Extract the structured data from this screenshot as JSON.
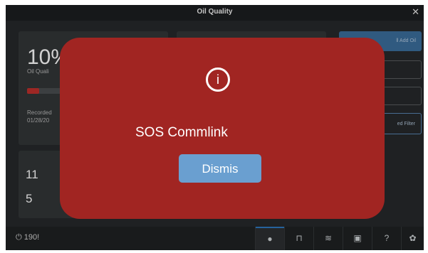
{
  "window": {
    "title": "Oil Quality",
    "close_icon": "close-icon"
  },
  "background": {
    "oil_card": {
      "percent": "10%",
      "label": "Oil Quali",
      "quality_fraction": 0.1,
      "recorded_label": "Recorded",
      "recorded_date": "01/28/20"
    },
    "counts_card": {
      "value_1": "11",
      "value_2": "5"
    },
    "side_buttons": {
      "add_oil": "ll Add Oil",
      "filter": "ed Filter"
    }
  },
  "footer": {
    "power_label": "190",
    "power_cursor": "!",
    "tabs": [
      {
        "icon": "oil-drop-icon",
        "glyph": "●"
      },
      {
        "icon": "filter-icon",
        "glyph": "⊓"
      },
      {
        "icon": "wifi-icon",
        "glyph": "≋"
      },
      {
        "icon": "manual-icon",
        "glyph": "▣"
      },
      {
        "icon": "help-icon",
        "glyph": "?"
      },
      {
        "icon": "settings-icon",
        "glyph": "✿"
      }
    ]
  },
  "modal": {
    "info_icon_glyph": "i",
    "title": "SOS Commlink",
    "dismiss_label": "Dismis"
  },
  "colors": {
    "modal_bg": "#a12522",
    "dismiss_bg": "#6a9fd0",
    "accent_blue": "#2f78c0",
    "bar_red": "#c0302c"
  }
}
